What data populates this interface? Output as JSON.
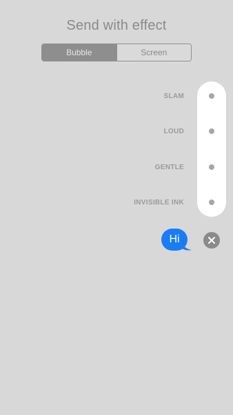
{
  "header": {
    "title": "Send with effect"
  },
  "tabs": {
    "bubble_label": "Bubble",
    "screen_label": "Screen",
    "selected": "Bubble"
  },
  "effects": [
    {
      "label": "SLAM"
    },
    {
      "label": "LOUD"
    },
    {
      "label": "GENTLE"
    },
    {
      "label": "INVISIBLE INK"
    }
  ],
  "message": {
    "text": "Hi"
  },
  "icons": {
    "cancel": "close-icon"
  },
  "colors": {
    "background": "#d8d8d8",
    "bubble": "#1a7cf5",
    "track": "#ffffff",
    "segment_active": "#8e8e8e"
  }
}
